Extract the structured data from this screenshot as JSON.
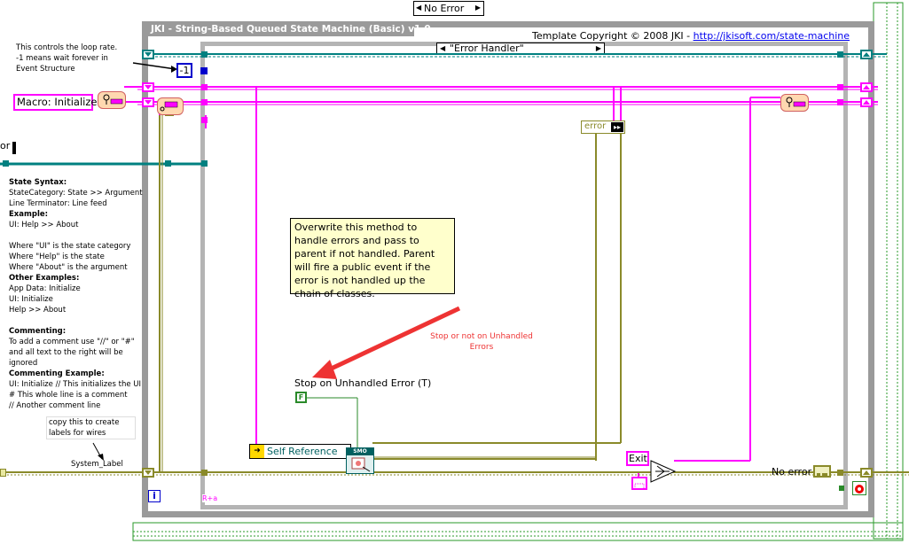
{
  "error_selector": {
    "label": "No Error",
    "left_arrow": "◀",
    "right_arrow": "▶"
  },
  "loop_title": "JKI - String-Based Queued State Machine (Basic) v1.0",
  "copyright": {
    "text": "Template Copyright © 2008 JKI - ",
    "link": "http://jkisoft.com/state-machine"
  },
  "case_selector": {
    "label": "\"Error Handler\"",
    "left_arrow": "◀",
    "right_arrow": "▶"
  },
  "loop_rate_comment": "This controls the loop rate. -1 means wait forever in Event Structure",
  "timeout_constant": "-1",
  "macro_constant": "Macro: Initialize",
  "cut_label": "or",
  "state_syntax": [
    {
      "text": "State Syntax:",
      "bold": true
    },
    {
      "text": "StateCategory: State >> Argument",
      "bold": false
    },
    {
      "text": "Line Terminator: Line feed",
      "bold": false
    },
    {
      "text": "Example:",
      "bold": true
    },
    {
      "text": "UI: Help >> About",
      "bold": false
    },
    {
      "text": "",
      "bold": false
    },
    {
      "text": "Where \"UI\" is the state category",
      "bold": false
    },
    {
      "text": "Where \"Help\" is the state",
      "bold": false
    },
    {
      "text": "Where \"About\" is the argument",
      "bold": false
    },
    {
      "text": "Other Examples:",
      "bold": true
    },
    {
      "text": "App Data: Initialize",
      "bold": false
    },
    {
      "text": "UI: Initialize",
      "bold": false
    },
    {
      "text": "Help >> About",
      "bold": false
    },
    {
      "text": "",
      "bold": false
    },
    {
      "text": "Commenting:",
      "bold": true
    },
    {
      "text": "To add a comment use \"//\" or \"#\"",
      "bold": false
    },
    {
      "text": "and all text to the right will be",
      "bold": false
    },
    {
      "text": "ignored",
      "bold": false
    },
    {
      "text": "Commenting Example:",
      "bold": true
    },
    {
      "text": "UI: Initialize // This initializes the UI",
      "bold": false
    },
    {
      "text": "# This whole line is a comment",
      "bold": false
    },
    {
      "text": "// Another comment line",
      "bold": false
    }
  ],
  "wire_label_comment": "copy this to create labels for wires",
  "system_label": "System_Label",
  "error_unbundle_label": "error",
  "note_text": "Overwrite this method to handle errors and pass to parent if not handled. Parent will fire a public event if the error is not handled up the chain of classes.",
  "red_note": "Stop or not on Unhandled Errors",
  "stop_label": "Stop on Unhandled Error (T)",
  "stop_constant": "F",
  "self_reference_label": "Self Reference",
  "method_icon_label": "SMO",
  "exit_constant": "Exit",
  "no_error_label": "No error",
  "info_icon": "i",
  "string_label": "R+a",
  "colors": {
    "pink_wire": "#ff00ff",
    "teal_wire": "#008080",
    "error_wire": "#8a8a2a",
    "loop_border": "#9a9a9a",
    "case_border": "#b4b4b4",
    "note_bg": "#ffffcc",
    "red_arrow": "#ee3333"
  }
}
